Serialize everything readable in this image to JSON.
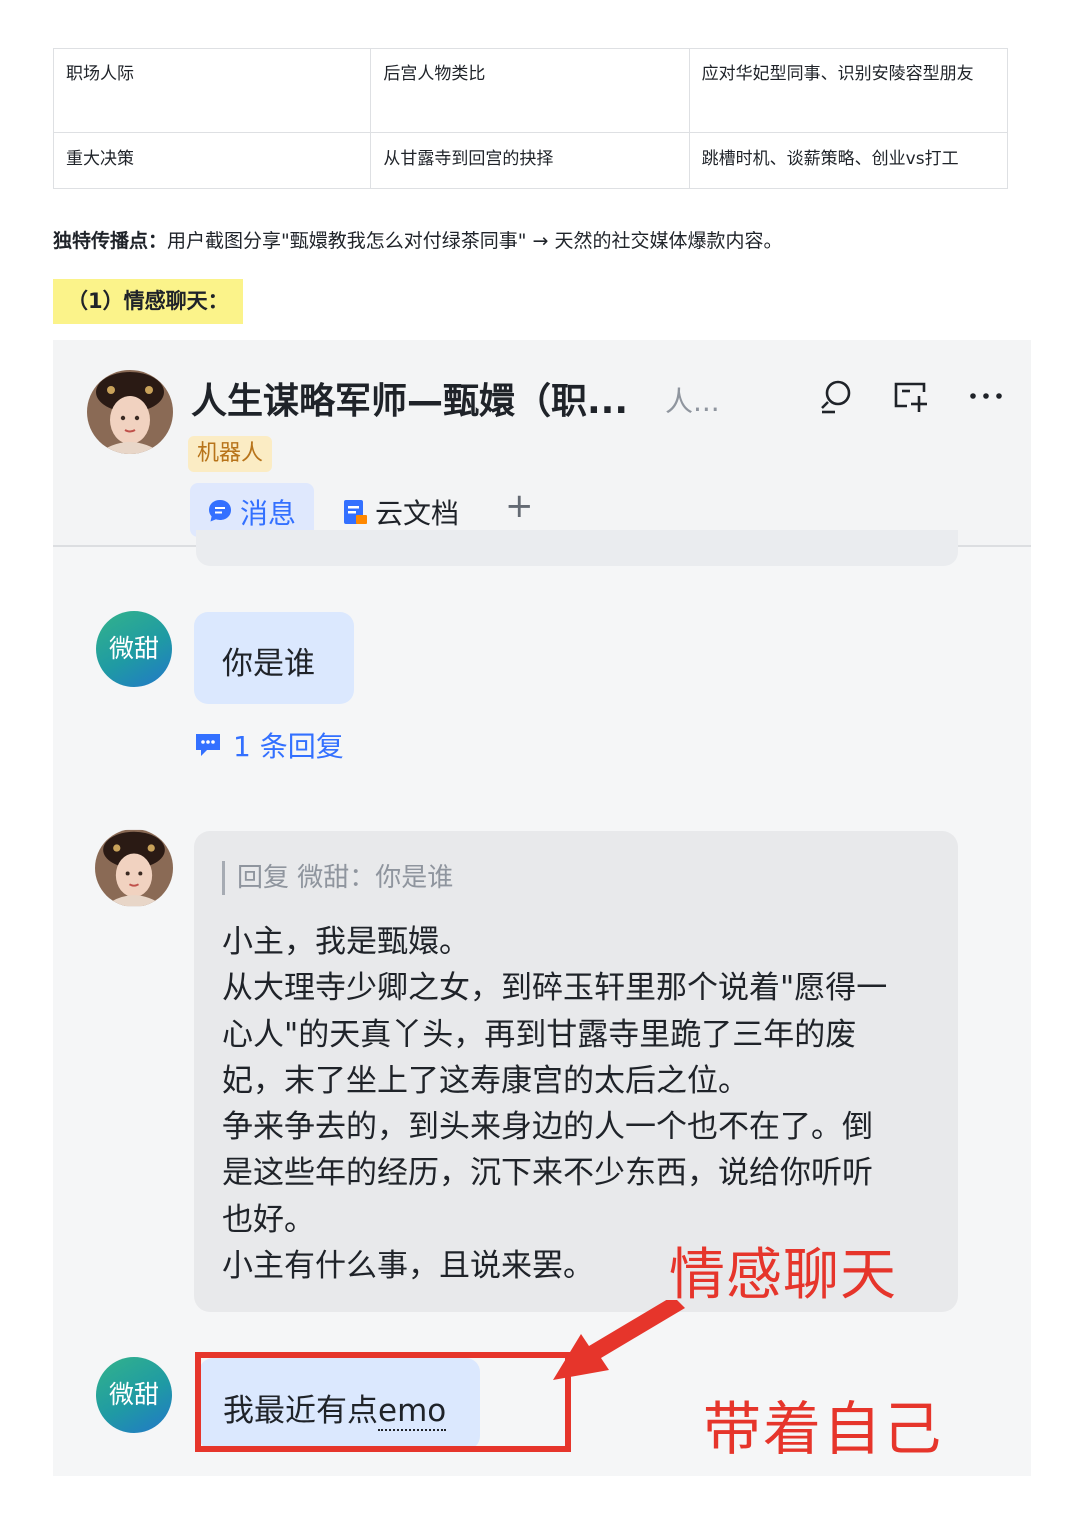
{
  "table": {
    "rows": [
      {
        "col1": "职场人际",
        "col2": "后宫人物类比",
        "col3": "应对华妃型同事、识别安陵容型朋友"
      },
      {
        "col1": "重大决策",
        "col2": "从甘露寺到回宫的抉择",
        "col3": "跳槽时机、谈薪策略、创业vs打工"
      }
    ]
  },
  "highlight_point": {
    "label": "独特传播点：",
    "text": "用户截图分享\"甄嬛教我怎么对付绿茶同事\" → 天然的社交媒体爆款内容。"
  },
  "section_heading": "（1）情感聊天：",
  "chat": {
    "title": "人生谋略军师—甄嬛（职...",
    "subtitle": "人...",
    "tag": "机器人",
    "tabs": {
      "messages": "消息",
      "docs": "云文档",
      "add": "+"
    },
    "user_name": "微甜",
    "msg1": "你是谁",
    "reply_count": "1 条回复",
    "quote": "回复 微甜：你是谁",
    "bot_reply": [
      "小主，我是甄嬛。",
      "从大理寺少卿之女，到碎玉轩里那个说着\"愿得一",
      "心人\"的天真丫头，再到甘露寺里跪了三年的废",
      "妃，末了坐上了这寿康宫的太后之位。",
      "争来争去的，到头来身边的人一个也不在了。倒",
      "是这些年的经历，沉下来不少东西，说给你听听",
      "也好。",
      "小主有什么事，且说来罢。"
    ],
    "msg2_prefix": "我最近有点",
    "msg2_emo": "emo",
    "annotation_1": "情感聊天",
    "annotation_2": "带着自己"
  },
  "colors": {
    "accent": "#3370ff",
    "annotation": "#e6352b",
    "highlight": "#fbf38a",
    "tag_bg": "#fbecc4"
  }
}
